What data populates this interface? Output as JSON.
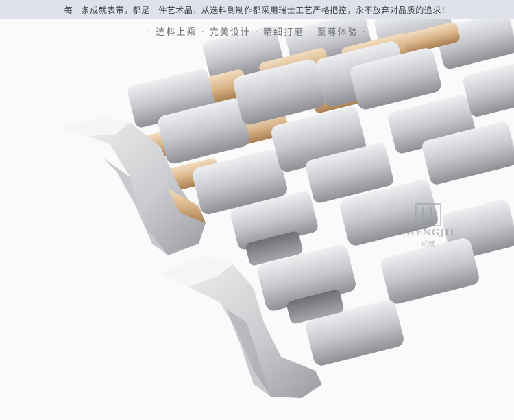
{
  "banner": {
    "text": "每一条成就表带，都是一件艺术品，从选料到制作都采用瑞士工艺严格把控，永不放弃对品质的追求！"
  },
  "tagline": {
    "text": "· 选料上乘 · 完美设计 · 精细打磨 · 至尊体验 ·"
  },
  "watermark": {
    "brand": "CHENGJIU",
    "cn": "成就"
  },
  "colors": {
    "background": "#fafafa",
    "steel_light": "#d9d9db",
    "steel_dark": "#8e9096",
    "gold": "#d9b58a",
    "banner": "#dfe2e8"
  },
  "image_content": {
    "subject": "two stainless steel watch bracelets, one two-tone steel and rose gold, one brushed steel, with curved end links"
  }
}
